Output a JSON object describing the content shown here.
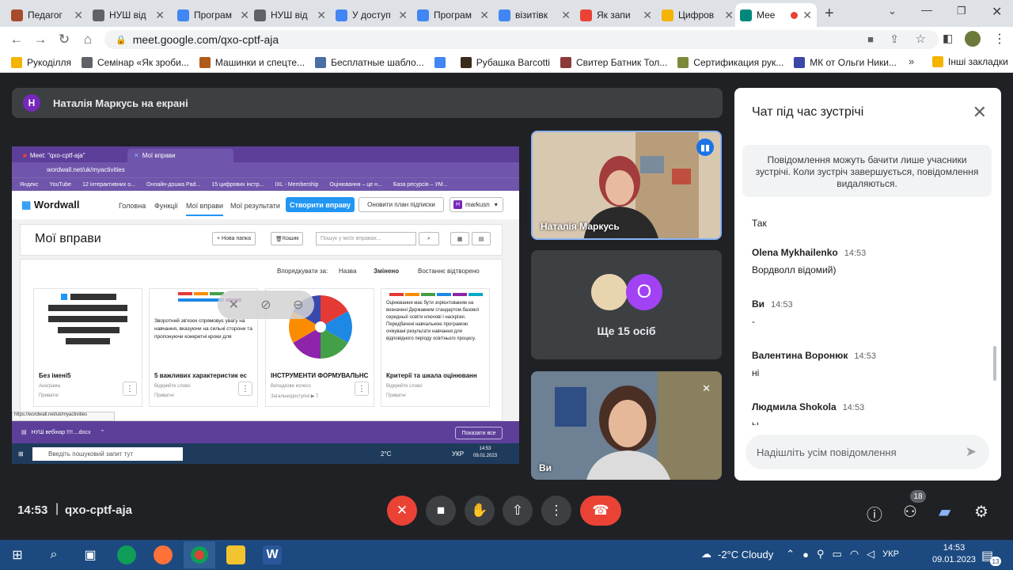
{
  "browser": {
    "tabs": [
      {
        "label": "Педагог",
        "color": "#a64c2d"
      },
      {
        "label": "НУШ від",
        "color": "#5f6368"
      },
      {
        "label": "Програм",
        "color": "#4285f4"
      },
      {
        "label": "НУШ від",
        "color": "#5f6368"
      },
      {
        "label": "У доступ",
        "color": "#4285f4"
      },
      {
        "label": "Програм",
        "color": "#4285f4"
      },
      {
        "label": "візитівк",
        "color": "#4285f4"
      },
      {
        "label": "Як запи",
        "color": "#ea4335"
      },
      {
        "label": "Цифров",
        "color": "#f4b400"
      },
      {
        "label": "Мее",
        "color": "#00897b"
      }
    ],
    "address": "meet.google.com/qxo-cptf-aja",
    "bookmarks": [
      {
        "label": "Рукоділля",
        "color": "#f4b400"
      },
      {
        "label": "Семінар «Як зроби...",
        "color": "#5f6368"
      },
      {
        "label": "Машинки и спецте...",
        "color": "#b05a1c"
      },
      {
        "label": "Бесплатные шабло...",
        "color": "#4a6fa5"
      },
      {
        "label": "",
        "color": "#4285f4"
      },
      {
        "label": "Рубашка Barcotti",
        "color": "#3a2a1a"
      },
      {
        "label": "Свитер Батник Тол...",
        "color": "#8b3a3a"
      },
      {
        "label": "Сертификация рук...",
        "color": "#7b8a3a"
      },
      {
        "label": "МК от Ольги Ники...",
        "color": "#3a47a5"
      }
    ],
    "other_bookmarks": "Інші закладки"
  },
  "meet": {
    "presenting_initial": "Н",
    "presenting_text": "Наталія Маркусь на екрані",
    "tiles": {
      "speaker": "Наталія Маркусь",
      "others_initial": "О",
      "others_count": "Ще 15 осіб",
      "self": "Ви"
    },
    "time": "14:53",
    "code": "qxo-cptf-aja",
    "participants_badge": "18"
  },
  "chat": {
    "title": "Чат під час зустрічі",
    "note": "Повідомлення можуть бачити лише учасники зустрічі. Коли зустріч завершується, повідомлення видаляються.",
    "messages": [
      {
        "author": "",
        "time": "",
        "text": "Так"
      },
      {
        "author": "Olena Mykhailenko",
        "time": "14:53",
        "text": "Вордволл відомий)"
      },
      {
        "author": "Ви",
        "time": "14:53",
        "text": "-"
      },
      {
        "author": "Валентина Воронюк",
        "time": "14:53",
        "text": "ні"
      },
      {
        "author": "Людмила Shokola",
        "time": "14:53",
        "text": "ы"
      }
    ],
    "placeholder": "Надішліть усім повідомлення"
  },
  "share": {
    "tab1": "Meet: \"qxo-cptf-aja\"",
    "tab2": "Мої вправи",
    "address": "wordwall.net/uk/myactivities",
    "bookmarks": [
      "Яндекс",
      "YouTube",
      "12 інтерактивних о...",
      "Онлайн-дошка Pad...",
      "15 цифрових інстр...",
      "IXL - Membership",
      "Оцінювання – це н...",
      "База ресурсів – УМ..."
    ],
    "logo": "Wordwall",
    "nav": [
      "Головна",
      "Функції",
      "Мої вправи",
      "Мої результати"
    ],
    "create": "Створити вправу",
    "plan": "Оновити план підписки",
    "user_initial": "H",
    "user": "markusn",
    "page_title": "Мої вправи",
    "new_folder": "+ Нова папка",
    "trash": "Кошик",
    "search": "Пошук у моїх вправах...",
    "sort_label": "Впорядкувати за:",
    "sort": [
      "Назва",
      "Змінено",
      "Востаннє відтворено"
    ],
    "cards": [
      {
        "name": "Без імені5",
        "type": "Анаграма",
        "privacy": "Приватні"
      },
      {
        "name": "5 важливих характеристик ес",
        "type": "Відкрийте слово",
        "privacy": "Приватні"
      },
      {
        "name": "ІНСТРУМЕНТИ ФОРМУВАЛЬНС",
        "type": "Випадкове колесо",
        "privacy": "Загальнодоступні  ▶ 7"
      },
      {
        "name": "Критерії та шкала оцінюванн",
        "type": "Відкрийте слово",
        "privacy": "Приватні"
      }
    ],
    "card2_text": "Зворотний зв'язок спрямовує увагу на навчання, вказуючи на сильні сторони та пропонуючи конкретні кроки для",
    "card4_text": "Оцінювання має бути зорієнтованим на визначені Державним стандартом базової середньої освіти ключові і наскрізні. Передбачені навчальною програмою очікувані результати навчання для відповідного періоду освітнього процесу.",
    "status_url": "https://wordwall.net/uk/myactivities",
    "download": "НУШ вебінар !!!!....docx",
    "show_all": "Показати все",
    "win_search": "Введіть пошуковий запит тут",
    "win_weather": "2°C",
    "win_lang": "УКР",
    "win_time": "14:53",
    "win_date": "09.01.2023"
  },
  "taskbar": {
    "weather": "-2°C  Cloudy",
    "lang": "УКР",
    "time": "14:53",
    "date": "09.01.2023",
    "notif": "13"
  }
}
